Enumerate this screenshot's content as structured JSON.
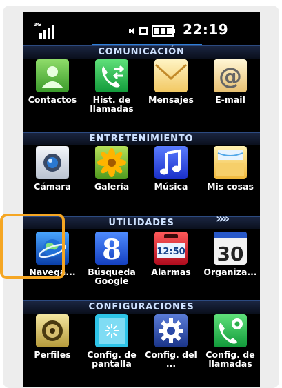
{
  "status": {
    "network_label": "3G",
    "time": "22:19"
  },
  "sections": [
    {
      "title": "COMUNICACIÓN"
    },
    {
      "title": "ENTRETENIMIENTO"
    },
    {
      "title": "UTILIDADES",
      "more_glyph": "»»"
    },
    {
      "title": "CONFIGURACIONES"
    }
  ],
  "apps": {
    "contactos": "Contactos",
    "historial": "Hist. de llamadas",
    "mensajes": "Mensajes",
    "email": "E-mail",
    "camara": "Cámara",
    "galeria": "Galería",
    "musica": "Música",
    "mis_cosas": "Mis cosas",
    "navegador": "Navega...",
    "busqueda": "Búsqueda Google",
    "alarmas": "Alarmas",
    "organizador": "Organiza...",
    "perfiles": "Perfiles",
    "config_pantalla": "Config. de pantalla",
    "config_del": "Config. del ...",
    "config_llamadas": "Config. de llamadas"
  },
  "icon_text": {
    "google_g": "8",
    "alarm_time": "12:50",
    "calendar_day": "30",
    "email_at": "@"
  },
  "colors": {
    "highlight": "#f5a623",
    "section_text": "#cfe2ff",
    "accent_line": "#2f7fd8"
  }
}
